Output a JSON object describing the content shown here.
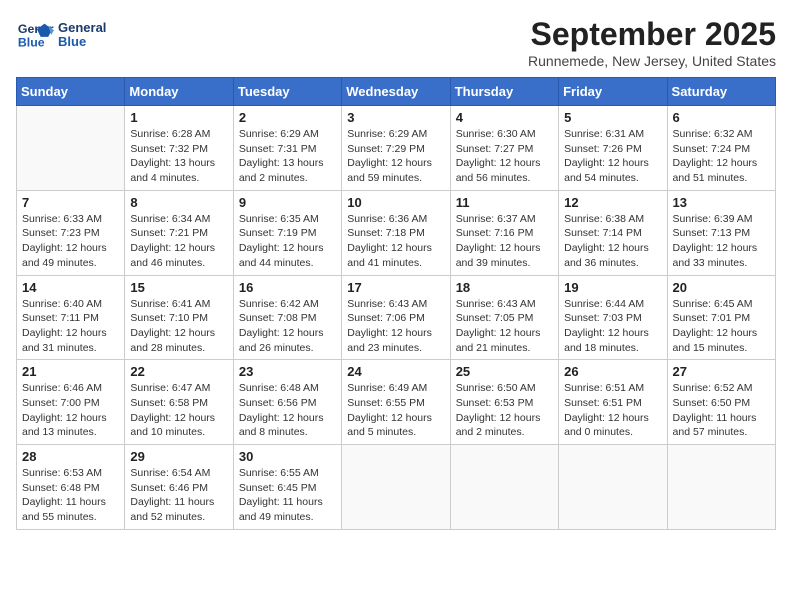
{
  "logo": {
    "line1": "General",
    "line2": "Blue"
  },
  "title": "September 2025",
  "subtitle": "Runnemede, New Jersey, United States",
  "days_of_week": [
    "Sunday",
    "Monday",
    "Tuesday",
    "Wednesday",
    "Thursday",
    "Friday",
    "Saturday"
  ],
  "weeks": [
    [
      {
        "num": "",
        "sunrise": "",
        "sunset": "",
        "daylight": ""
      },
      {
        "num": "1",
        "sunrise": "Sunrise: 6:28 AM",
        "sunset": "Sunset: 7:32 PM",
        "daylight": "Daylight: 13 hours and 4 minutes."
      },
      {
        "num": "2",
        "sunrise": "Sunrise: 6:29 AM",
        "sunset": "Sunset: 7:31 PM",
        "daylight": "Daylight: 13 hours and 2 minutes."
      },
      {
        "num": "3",
        "sunrise": "Sunrise: 6:29 AM",
        "sunset": "Sunset: 7:29 PM",
        "daylight": "Daylight: 12 hours and 59 minutes."
      },
      {
        "num": "4",
        "sunrise": "Sunrise: 6:30 AM",
        "sunset": "Sunset: 7:27 PM",
        "daylight": "Daylight: 12 hours and 56 minutes."
      },
      {
        "num": "5",
        "sunrise": "Sunrise: 6:31 AM",
        "sunset": "Sunset: 7:26 PM",
        "daylight": "Daylight: 12 hours and 54 minutes."
      },
      {
        "num": "6",
        "sunrise": "Sunrise: 6:32 AM",
        "sunset": "Sunset: 7:24 PM",
        "daylight": "Daylight: 12 hours and 51 minutes."
      }
    ],
    [
      {
        "num": "7",
        "sunrise": "Sunrise: 6:33 AM",
        "sunset": "Sunset: 7:23 PM",
        "daylight": "Daylight: 12 hours and 49 minutes."
      },
      {
        "num": "8",
        "sunrise": "Sunrise: 6:34 AM",
        "sunset": "Sunset: 7:21 PM",
        "daylight": "Daylight: 12 hours and 46 minutes."
      },
      {
        "num": "9",
        "sunrise": "Sunrise: 6:35 AM",
        "sunset": "Sunset: 7:19 PM",
        "daylight": "Daylight: 12 hours and 44 minutes."
      },
      {
        "num": "10",
        "sunrise": "Sunrise: 6:36 AM",
        "sunset": "Sunset: 7:18 PM",
        "daylight": "Daylight: 12 hours and 41 minutes."
      },
      {
        "num": "11",
        "sunrise": "Sunrise: 6:37 AM",
        "sunset": "Sunset: 7:16 PM",
        "daylight": "Daylight: 12 hours and 39 minutes."
      },
      {
        "num": "12",
        "sunrise": "Sunrise: 6:38 AM",
        "sunset": "Sunset: 7:14 PM",
        "daylight": "Daylight: 12 hours and 36 minutes."
      },
      {
        "num": "13",
        "sunrise": "Sunrise: 6:39 AM",
        "sunset": "Sunset: 7:13 PM",
        "daylight": "Daylight: 12 hours and 33 minutes."
      }
    ],
    [
      {
        "num": "14",
        "sunrise": "Sunrise: 6:40 AM",
        "sunset": "Sunset: 7:11 PM",
        "daylight": "Daylight: 12 hours and 31 minutes."
      },
      {
        "num": "15",
        "sunrise": "Sunrise: 6:41 AM",
        "sunset": "Sunset: 7:10 PM",
        "daylight": "Daylight: 12 hours and 28 minutes."
      },
      {
        "num": "16",
        "sunrise": "Sunrise: 6:42 AM",
        "sunset": "Sunset: 7:08 PM",
        "daylight": "Daylight: 12 hours and 26 minutes."
      },
      {
        "num": "17",
        "sunrise": "Sunrise: 6:43 AM",
        "sunset": "Sunset: 7:06 PM",
        "daylight": "Daylight: 12 hours and 23 minutes."
      },
      {
        "num": "18",
        "sunrise": "Sunrise: 6:43 AM",
        "sunset": "Sunset: 7:05 PM",
        "daylight": "Daylight: 12 hours and 21 minutes."
      },
      {
        "num": "19",
        "sunrise": "Sunrise: 6:44 AM",
        "sunset": "Sunset: 7:03 PM",
        "daylight": "Daylight: 12 hours and 18 minutes."
      },
      {
        "num": "20",
        "sunrise": "Sunrise: 6:45 AM",
        "sunset": "Sunset: 7:01 PM",
        "daylight": "Daylight: 12 hours and 15 minutes."
      }
    ],
    [
      {
        "num": "21",
        "sunrise": "Sunrise: 6:46 AM",
        "sunset": "Sunset: 7:00 PM",
        "daylight": "Daylight: 12 hours and 13 minutes."
      },
      {
        "num": "22",
        "sunrise": "Sunrise: 6:47 AM",
        "sunset": "Sunset: 6:58 PM",
        "daylight": "Daylight: 12 hours and 10 minutes."
      },
      {
        "num": "23",
        "sunrise": "Sunrise: 6:48 AM",
        "sunset": "Sunset: 6:56 PM",
        "daylight": "Daylight: 12 hours and 8 minutes."
      },
      {
        "num": "24",
        "sunrise": "Sunrise: 6:49 AM",
        "sunset": "Sunset: 6:55 PM",
        "daylight": "Daylight: 12 hours and 5 minutes."
      },
      {
        "num": "25",
        "sunrise": "Sunrise: 6:50 AM",
        "sunset": "Sunset: 6:53 PM",
        "daylight": "Daylight: 12 hours and 2 minutes."
      },
      {
        "num": "26",
        "sunrise": "Sunrise: 6:51 AM",
        "sunset": "Sunset: 6:51 PM",
        "daylight": "Daylight: 12 hours and 0 minutes."
      },
      {
        "num": "27",
        "sunrise": "Sunrise: 6:52 AM",
        "sunset": "Sunset: 6:50 PM",
        "daylight": "Daylight: 11 hours and 57 minutes."
      }
    ],
    [
      {
        "num": "28",
        "sunrise": "Sunrise: 6:53 AM",
        "sunset": "Sunset: 6:48 PM",
        "daylight": "Daylight: 11 hours and 55 minutes."
      },
      {
        "num": "29",
        "sunrise": "Sunrise: 6:54 AM",
        "sunset": "Sunset: 6:46 PM",
        "daylight": "Daylight: 11 hours and 52 minutes."
      },
      {
        "num": "30",
        "sunrise": "Sunrise: 6:55 AM",
        "sunset": "Sunset: 6:45 PM",
        "daylight": "Daylight: 11 hours and 49 minutes."
      },
      {
        "num": "",
        "sunrise": "",
        "sunset": "",
        "daylight": ""
      },
      {
        "num": "",
        "sunrise": "",
        "sunset": "",
        "daylight": ""
      },
      {
        "num": "",
        "sunrise": "",
        "sunset": "",
        "daylight": ""
      },
      {
        "num": "",
        "sunrise": "",
        "sunset": "",
        "daylight": ""
      }
    ]
  ]
}
